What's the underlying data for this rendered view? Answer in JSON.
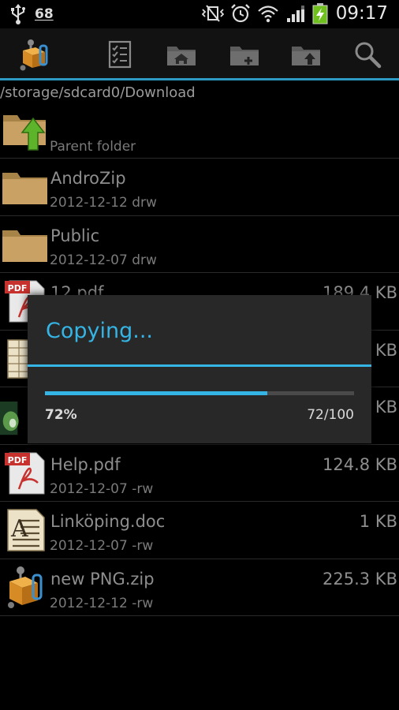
{
  "status_bar": {
    "notification_count": "68",
    "time": "09:17",
    "icons": [
      "usb-icon",
      "vibrate-icon",
      "alarm-icon",
      "wifi-icon",
      "signal-icon",
      "battery-charging-icon"
    ]
  },
  "action_bar": {
    "buttons": [
      "app-logo-icon",
      "select-checklist-icon",
      "home-folder-icon",
      "new-folder-icon",
      "up-folder-icon",
      "search-icon"
    ],
    "accent_color": "#2d9ac4"
  },
  "path": "/storage/sdcard0/Download",
  "files": [
    {
      "name": "",
      "meta": "Parent folder",
      "size": "",
      "icon": "parent-folder-icon"
    },
    {
      "name": "AndroZip",
      "meta": "2012-12-12 drw",
      "size": "",
      "icon": "folder-icon"
    },
    {
      "name": "Public",
      "meta": "2012-12-07 drw",
      "size": "",
      "icon": "folder-icon"
    },
    {
      "name": "12.pdf",
      "meta": "",
      "size": "189.4 KB",
      "icon": "pdf-icon"
    },
    {
      "name": "",
      "meta": "",
      "size": "KB",
      "icon": "spreadsheet-icon"
    },
    {
      "name": "",
      "meta": "",
      "size": "KB",
      "icon": "image-thumbnail-icon"
    },
    {
      "name": "Help.pdf",
      "meta": "2012-12-07 -rw",
      "size": "124.8 KB",
      "icon": "pdf-icon"
    },
    {
      "name": "Linköping.doc",
      "meta": "2012-12-07 -rw",
      "size": "1 KB",
      "icon": "document-icon"
    },
    {
      "name": "new PNG.zip",
      "meta": "2012-12-12 -rw",
      "size": "225.3 KB",
      "icon": "zip-archive-icon"
    }
  ],
  "dialog": {
    "title": "Copying...",
    "percent_label": "72%",
    "count_label": "72/100",
    "progress": 0.72,
    "accent_color": "#35b5e5"
  }
}
